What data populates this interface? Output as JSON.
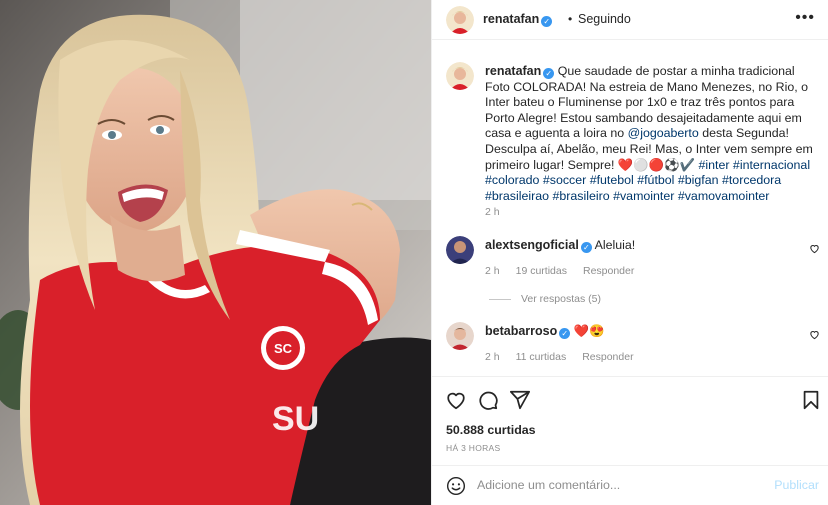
{
  "post": {
    "author": "renatafan",
    "follow_status": "Seguindo",
    "separator": "•",
    "more_icon": "more-horizontal-icon"
  },
  "caption": {
    "username": "renatafan",
    "text_part1": "Que saudade de postar a minha tradicional Foto COLORADA! Na estreia de Mano Menezes, no Rio, o Inter bateu o Fluminense por 1x0 e traz três pontos para Porto Alegre! Estou sambando desajeitadamente aqui em casa e aguenta a loira no ",
    "mention": "@jogoaberto",
    "text_part2": " desta Segunda! Desculpa aí, Abelão, meu Rei! Mas, o Inter vem sempre em primeiro lugar! Sempre! ❤️⚪🔴⚽✔️ ",
    "hashtags": "#inter #internacional #colorado #soccer #futebol #fútbol #bigfan #torcedora #brasileirao #brasileiro #vamointer #vamovamointer",
    "time": "2 h"
  },
  "comments": [
    {
      "username": "alextsengoficial",
      "text": "Aleluia!",
      "time": "2 h",
      "likes": "19 curtidas",
      "reply": "Responder"
    },
    {
      "username": "betabarroso",
      "text": "❤️😍",
      "time": "2 h",
      "likes": "11 curtidas",
      "reply": "Responder"
    }
  ],
  "view_replies": "Ver respostas (5)",
  "engagement": {
    "likes": "50.888 curtidas",
    "posted_ago": "HÁ 3 HORAS"
  },
  "composer": {
    "placeholder": "Adicione um comentário...",
    "publish": "Publicar"
  },
  "colors": {
    "verified": "#3897f0",
    "link": "#00376b",
    "muted": "#8e8e8e",
    "jersey_red": "#d9202a",
    "heart_red": "#ed4956"
  }
}
